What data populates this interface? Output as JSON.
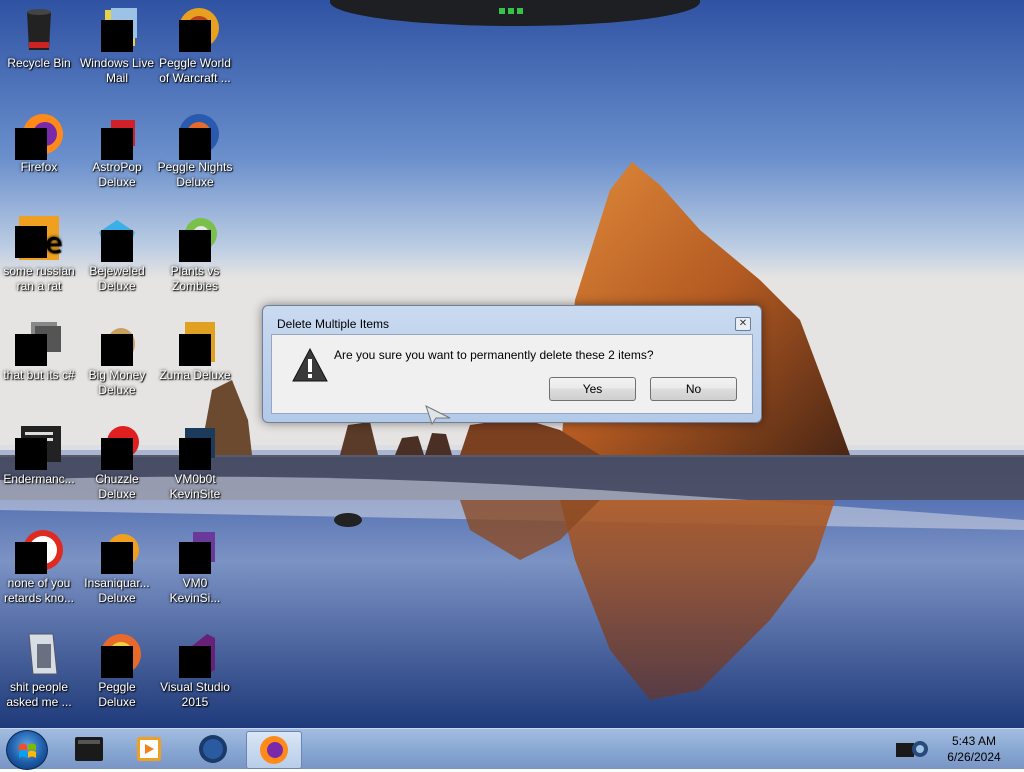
{
  "desktop": {
    "icons": [
      {
        "label": "Recycle Bin"
      },
      {
        "label": "Windows Live Mail"
      },
      {
        "label": "Peggle World of Warcraft ..."
      },
      {
        "label": "Firefox"
      },
      {
        "label": "AstroPop Deluxe"
      },
      {
        "label": "Peggle Nights Deluxe"
      },
      {
        "label": "some russian ran a rat"
      },
      {
        "label": "Bejeweled Deluxe"
      },
      {
        "label": "Plants vs Zombies"
      },
      {
        "label": "that but its c#"
      },
      {
        "label": "Big Money Deluxe"
      },
      {
        "label": "Zuma Deluxe"
      },
      {
        "label": "Endermanc..."
      },
      {
        "label": "Chuzzle Deluxe"
      },
      {
        "label": "VM0b0t KevinSite"
      },
      {
        "label": "none of you retards kno..."
      },
      {
        "label": "Insaniquar... Deluxe"
      },
      {
        "label": "VM0 KevinSi..."
      },
      {
        "label": "shit people asked me ..."
      },
      {
        "label": "Peggle Deluxe"
      },
      {
        "label": "Visual Studio 2015"
      }
    ]
  },
  "dialog": {
    "title": "Delete Multiple Items",
    "message": "Are you sure you want to permanently delete these 2 items?",
    "yes_label": "Yes",
    "no_label": "No",
    "close_glyph": "✕"
  },
  "taskbar": {
    "items": [
      "start-orb-icon",
      "terminal-icon",
      "media-player-icon",
      "globe-icon",
      "firefox-icon"
    ],
    "clock_time": "5:43 AM",
    "clock_date": "6/26/2024"
  },
  "colors": {
    "accent": "#4e75bd",
    "dialog_bg": "#f0f0f0",
    "taskbar": "#8aa8d4"
  }
}
